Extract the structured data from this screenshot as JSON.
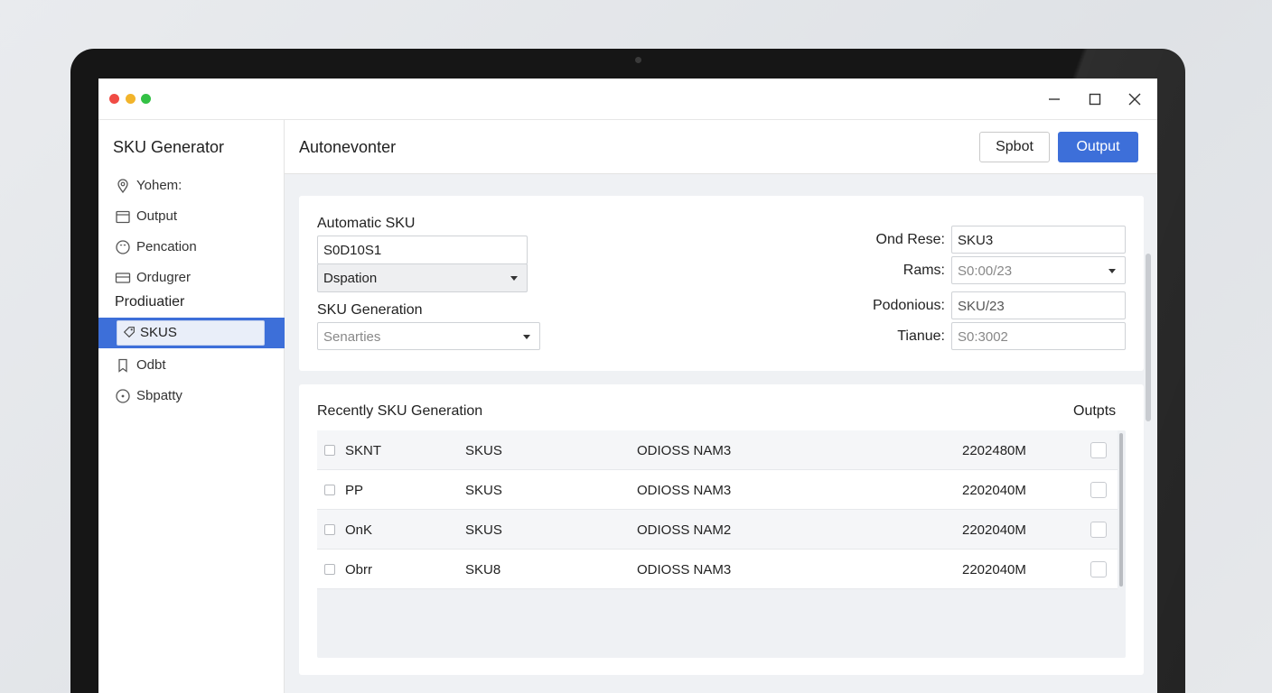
{
  "window": {
    "controls": [
      "minimize-icon",
      "maximize-icon",
      "close-icon"
    ]
  },
  "sidebar": {
    "title": "SKU Generator",
    "items": [
      {
        "label": "Yohem:",
        "icon": "location-pin-icon"
      },
      {
        "label": "Output",
        "icon": "calendar-icon"
      },
      {
        "label": "Pencation",
        "icon": "smile-icon"
      },
      {
        "label": "Ordugrer",
        "icon": "card-icon"
      }
    ],
    "section": "Prodiuatier",
    "section_items": [
      {
        "label": "SKUS",
        "icon": "tag-icon",
        "active": true
      },
      {
        "label": "Odbt",
        "icon": "bookmark-icon"
      },
      {
        "label": "Sbpatty",
        "icon": "clock-icon"
      }
    ]
  },
  "header": {
    "title": "Autonevonter",
    "split_label": "Spbot",
    "output_label": "Output"
  },
  "form": {
    "automatic_sku_label": "Automatic SKU",
    "automatic_sku_value": "S0D10S1",
    "dispatch_select": "Dspation",
    "sku_generation_label": "SKU Generation",
    "series_placeholder": "Senarties",
    "right_fields": [
      {
        "label": "Ond Rese:",
        "value": "SKU3"
      },
      {
        "label": "Rams:",
        "value": "S0:00/23"
      },
      {
        "label": "Podonious:",
        "value": "SKU/23"
      },
      {
        "label": "Tianue:",
        "value": "S0:3002"
      }
    ]
  },
  "recent": {
    "title": "Recently SKU Generation",
    "outputs_label": "Outpts",
    "rows": [
      {
        "c1": "SKNT",
        "c2": "SKUS",
        "c3": "ODIOSS NAM3",
        "c4": "2202480M"
      },
      {
        "c1": "PP",
        "c2": "SKUS",
        "c3": "ODIOSS NAM3",
        "c4": "2202040M"
      },
      {
        "c1": "OnK",
        "c2": "SKUS",
        "c3": "ODIOSS NAM2",
        "c4": "2202040M"
      },
      {
        "c1": "Obrr",
        "c2": "SKU8",
        "c3": "ODIOSS NAM3",
        "c4": "2202040M"
      }
    ]
  },
  "colors": {
    "accent": "#3d6fd9",
    "traffic_red": "#f04b44",
    "traffic_yellow": "#f2b42b",
    "traffic_green": "#33c145"
  }
}
